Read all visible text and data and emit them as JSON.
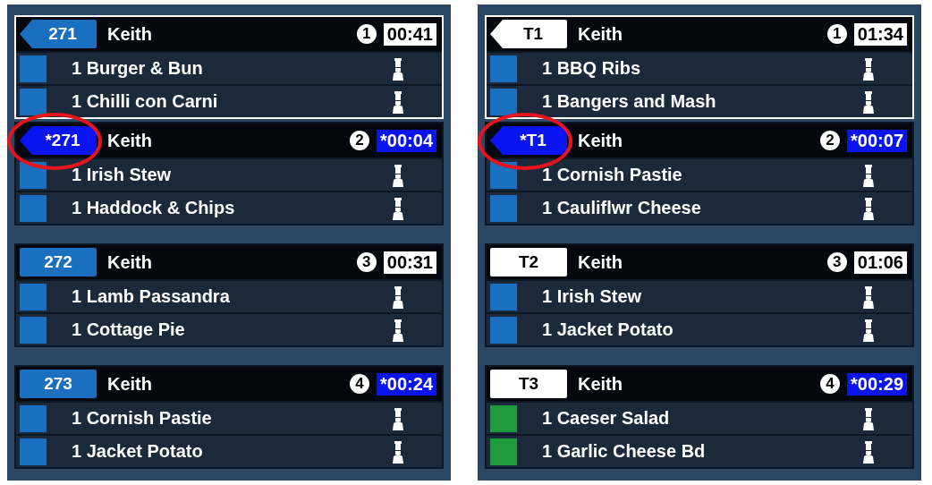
{
  "panels": [
    {
      "groups": [
        {
          "tickets": [
            {
              "tag": "271",
              "kind": "arrow",
              "color": "#1a6fbf",
              "name": "Keith",
              "seq": "1",
              "timer": "00:41",
              "rush": false,
              "selected": true,
              "circled": false,
              "items": [
                {
                  "text": "1 Burger & Bun",
                  "color": "#1a6fbf"
                },
                {
                  "text": "1 Chilli con Carni",
                  "color": "#1a6fbf"
                }
              ]
            },
            {
              "tag": "*271",
              "kind": "arrow",
              "color": "#0a14f0",
              "name": "Keith",
              "seq": "2",
              "timer": "*00:04",
              "rush": true,
              "selected": false,
              "circled": true,
              "items": [
                {
                  "text": "1 Irish Stew",
                  "color": "#1a6fbf"
                },
                {
                  "text": "1 Haddock & Chips",
                  "color": "#1a6fbf"
                }
              ]
            }
          ]
        },
        {
          "tickets": [
            {
              "tag": "272",
              "kind": "plain",
              "color": "#1a6fbf",
              "name": "Keith",
              "seq": "3",
              "timer": "00:31",
              "rush": false,
              "selected": false,
              "circled": false,
              "items": [
                {
                  "text": "1 Lamb Passandra",
                  "color": "#1a6fbf"
                },
                {
                  "text": "1 Cottage Pie",
                  "color": "#1a6fbf"
                }
              ]
            }
          ]
        },
        {
          "tickets": [
            {
              "tag": "273",
              "kind": "plain",
              "color": "#1a6fbf",
              "name": "Keith",
              "seq": "4",
              "timer": "*00:24",
              "rush": true,
              "selected": false,
              "circled": false,
              "items": [
                {
                  "text": "1 Cornish Pastie",
                  "color": "#1a6fbf"
                },
                {
                  "text": "1 Jacket Potato",
                  "color": "#1a6fbf"
                }
              ]
            }
          ]
        }
      ]
    },
    {
      "groups": [
        {
          "tickets": [
            {
              "tag": "T1",
              "kind": "arrow",
              "color": "#ffffff",
              "name": "Keith",
              "seq": "1",
              "timer": "01:34",
              "rush": false,
              "selected": true,
              "circled": false,
              "items": [
                {
                  "text": "1 BBQ Ribs",
                  "color": "#1a6fbf"
                },
                {
                  "text": "1 Bangers and Mash",
                  "color": "#1a6fbf"
                }
              ]
            },
            {
              "tag": "*T1",
              "kind": "arrow",
              "color": "#0a14f0",
              "name": "Keith",
              "seq": "2",
              "timer": "*00:07",
              "rush": true,
              "selected": false,
              "circled": true,
              "items": [
                {
                  "text": "1 Cornish Pastie",
                  "color": "#1a6fbf"
                },
                {
                  "text": "1 Cauliflwr Cheese",
                  "color": "#1a6fbf"
                }
              ]
            }
          ]
        },
        {
          "tickets": [
            {
              "tag": "T2",
              "kind": "plain",
              "color": "#ffffff",
              "name": "Keith",
              "seq": "3",
              "timer": "01:06",
              "rush": false,
              "selected": false,
              "circled": false,
              "items": [
                {
                  "text": "1 Irish Stew",
                  "color": "#1a6fbf"
                },
                {
                  "text": "1 Jacket Potato",
                  "color": "#1a6fbf"
                }
              ]
            }
          ]
        },
        {
          "tickets": [
            {
              "tag": "T3",
              "kind": "plain",
              "color": "#ffffff",
              "name": "Keith",
              "seq": "4",
              "timer": "*00:29",
              "rush": true,
              "selected": false,
              "circled": false,
              "items": [
                {
                  "text": "1 Caeser Salad",
                  "color": "#1f9a3c"
                },
                {
                  "text": "1 Garlic Cheese Bd",
                  "color": "#1f9a3c"
                }
              ]
            }
          ]
        }
      ]
    }
  ]
}
